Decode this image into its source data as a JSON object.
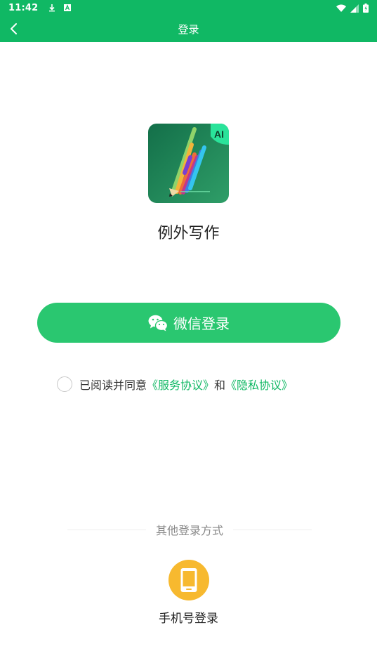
{
  "status_bar": {
    "time": "11:42"
  },
  "app_bar": {
    "title": "登录",
    "back_icon": "chevron-left-icon"
  },
  "brand": {
    "app_name": "例外写作",
    "logo_badge": "AI",
    "logo_colors": {
      "background": "#1b7a52",
      "badge": "#2ae39a"
    }
  },
  "login": {
    "wechat_button_label": "微信登录",
    "wechat_icon": "wechat-icon"
  },
  "agreement": {
    "prefix": "已阅读并同意",
    "service_link": "《服务协议》",
    "connector": "和",
    "privacy_link": "《隐私协议》"
  },
  "other_login": {
    "section_label": "其他登录方式",
    "phone_login_label": "手机号登录",
    "phone_icon": "phone-icon"
  },
  "colors": {
    "primary": "#10b864",
    "button": "#2ac770",
    "phone_circle": "#f7b92f",
    "link": "#10b864"
  }
}
